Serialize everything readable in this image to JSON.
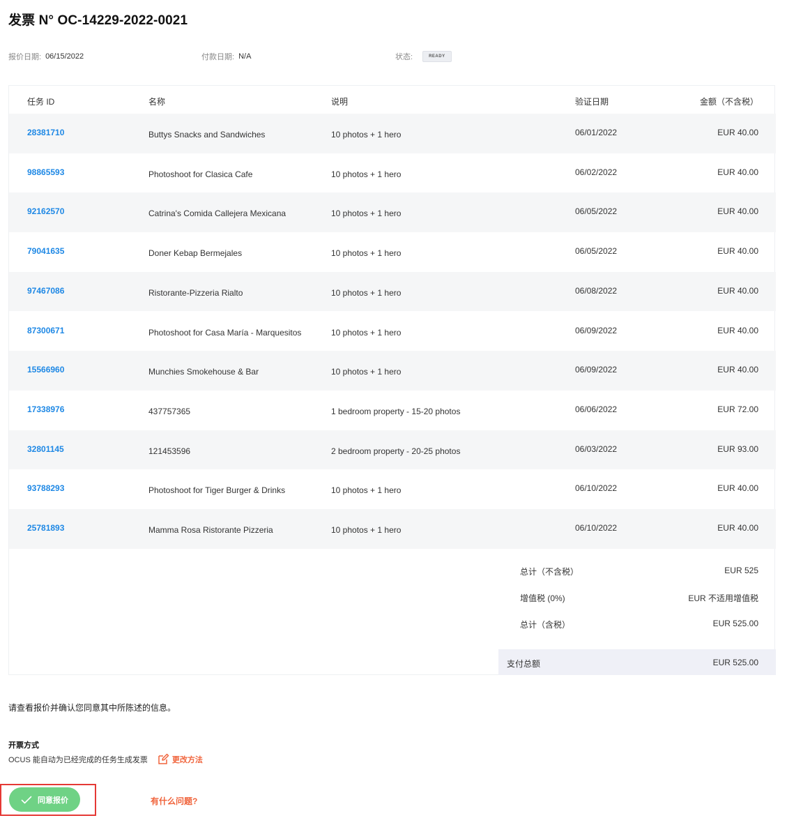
{
  "invoice": {
    "title": "发票 N° OC-14229-2022-0021",
    "quote_date_label": "报价日期:",
    "quote_date": "06/15/2022",
    "payment_date_label": "付款日期:",
    "payment_date": "N/A",
    "status_label": "状态:",
    "status": "READY"
  },
  "table": {
    "headers": [
      "任务 ID",
      "名称",
      "说明",
      "验证日期",
      "金额（不含税）"
    ],
    "rows": [
      {
        "id": "28381710",
        "name": "Buttys Snacks and Sandwiches",
        "desc": "10 photos + 1 hero",
        "date": "06/01/2022",
        "amount": "EUR 40.00"
      },
      {
        "id": "98865593",
        "name": "Photoshoot for Clasica Cafe",
        "desc": "10 photos + 1 hero",
        "date": "06/02/2022",
        "amount": "EUR 40.00"
      },
      {
        "id": "92162570",
        "name": "Catrina's Comida Callejera Mexicana",
        "desc": "10 photos + 1 hero",
        "date": "06/05/2022",
        "amount": "EUR 40.00"
      },
      {
        "id": "79041635",
        "name": "Doner Kebap Bermejales",
        "desc": "10 photos + 1 hero",
        "date": "06/05/2022",
        "amount": "EUR 40.00"
      },
      {
        "id": "97467086",
        "name": "Ristorante-Pizzeria Rialto",
        "desc": "10 photos + 1 hero",
        "date": "06/08/2022",
        "amount": "EUR 40.00"
      },
      {
        "id": "87300671",
        "name": "Photoshoot for Casa María - Marquesitos",
        "desc": "10 photos + 1 hero",
        "date": "06/09/2022",
        "amount": "EUR 40.00"
      },
      {
        "id": "15566960",
        "name": "Munchies Smokehouse & Bar",
        "desc": "10 photos + 1 hero",
        "date": "06/09/2022",
        "amount": "EUR 40.00"
      },
      {
        "id": "17338976",
        "name": "437757365",
        "desc": "1 bedroom property - 15-20 photos",
        "date": "06/06/2022",
        "amount": "EUR 72.00"
      },
      {
        "id": "32801145",
        "name": "121453596",
        "desc": "2 bedroom property - 20-25 photos",
        "date": "06/03/2022",
        "amount": "EUR 93.00"
      },
      {
        "id": "93788293",
        "name": "Photoshoot for Tiger Burger & Drinks",
        "desc": "10 photos + 1 hero",
        "date": "06/10/2022",
        "amount": "EUR 40.00"
      },
      {
        "id": "25781893",
        "name": "Mamma Rosa Ristorante Pizzeria",
        "desc": "10 photos + 1 hero",
        "date": "06/10/2022",
        "amount": "EUR 40.00"
      }
    ]
  },
  "summary": {
    "subtotal_label": "总计（不含税）",
    "subtotal": "EUR 525",
    "vat_label": "增值税 (0%)",
    "vat": "EUR 不适用增值税",
    "total_label": "总计（含税）",
    "total": "EUR 525.00",
    "pay_label": "支付总额",
    "pay": "EUR 525.00"
  },
  "footer": {
    "notice": "请查看报价并确认您同意其中所陈述的信息。",
    "method_title": "开票方式",
    "method_text": "OCUS 能自动为已经完成的任务生成发票",
    "change_label": "更改方法",
    "accept_label": "同意报价",
    "help_label": "有什么问题?"
  },
  "colors": {
    "link": "#1e88e5",
    "accent": "#f0643c",
    "accept": "#6fd285",
    "highlight_border": "#e53935"
  }
}
